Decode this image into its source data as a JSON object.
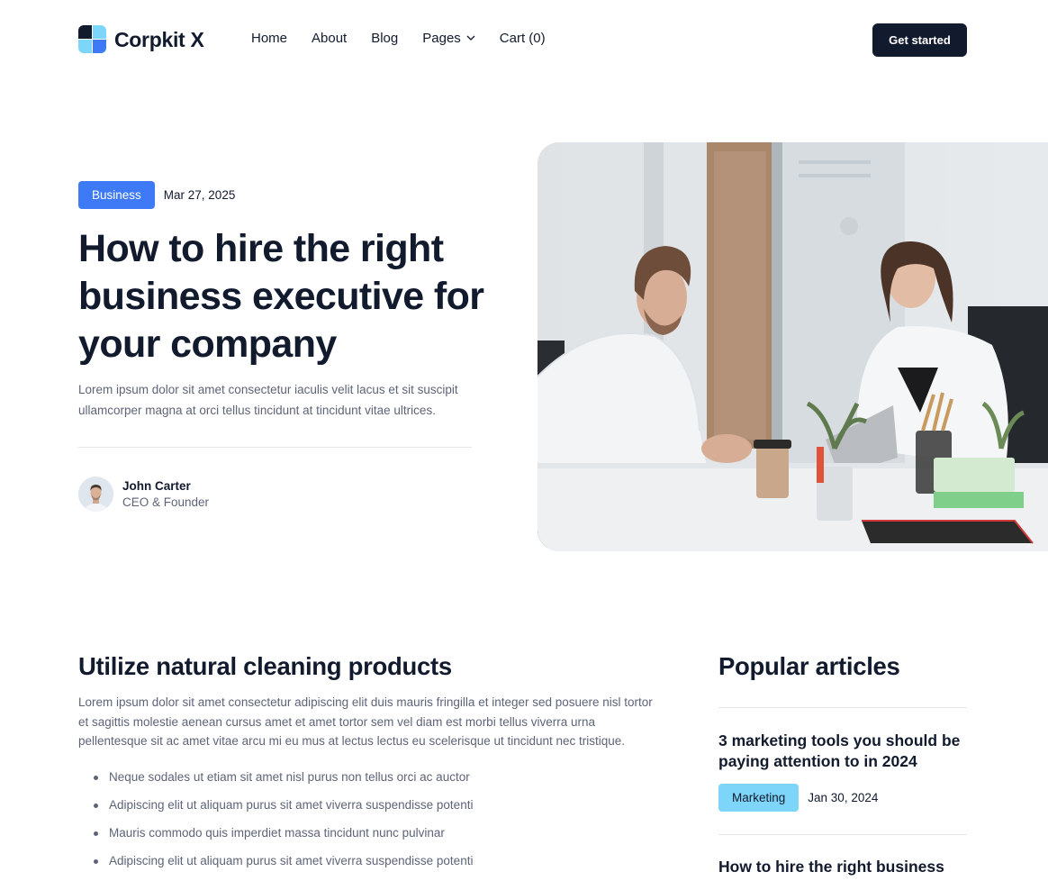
{
  "nav": {
    "brand": "Corpkit X",
    "links": [
      {
        "label": "Home"
      },
      {
        "label": "About"
      },
      {
        "label": "Blog"
      },
      {
        "label": "Pages",
        "has_dropdown": true
      },
      {
        "label": "Cart (0)"
      }
    ],
    "cta_label": "Get started"
  },
  "hero": {
    "category": "Business",
    "date": "Mar 27, 2025",
    "title": "How to hire the right business executive for your company",
    "description": "Lorem ipsum dolor sit amet consectetur iaculis velit lacus et sit suscipit ullamcorper magna at orci tellus tincidunt at tincidunt vitae ultrices.",
    "author": {
      "name": "John Carter",
      "role": "CEO & Founder"
    },
    "image_alt": "Two colleagues working together at an office desk"
  },
  "content": {
    "title": "Utilize natural cleaning products",
    "paragraph": "Lorem ipsum dolor sit amet consectetur adipiscing elit duis mauris fringilla et integer sed posuere nisl tortor et sagittis molestie aenean cursus amet et amet tortor sem vel diam est morbi tellus viverra urna pellentesque sit ac amet vitae arcu mi eu mus at lectus lectus eu scelerisque ut tincidunt nec tristique.",
    "bullets": [
      "Neque sodales ut etiam sit amet nisl purus non tellus orci ac auctor",
      "Adipiscing elit ut aliquam purus sit amet viverra suspendisse potenti",
      "Mauris commodo quis imperdiet massa tincidunt nunc pulvinar",
      "Adipiscing elit ut aliquam purus sit amet viverra suspendisse potenti"
    ]
  },
  "sidebar": {
    "title": "Popular articles",
    "articles": [
      {
        "title": "3 marketing tools you should be paying attention to in 2024",
        "category": "Marketing",
        "date": "Jan 30, 2024"
      },
      {
        "title": "How to hire the right business"
      }
    ]
  },
  "colors": {
    "primary_dark": "#121a2e",
    "accent_blue": "#3f7af6",
    "accent_cyan": "#7dd6f9",
    "body_text": "#5e6478"
  }
}
